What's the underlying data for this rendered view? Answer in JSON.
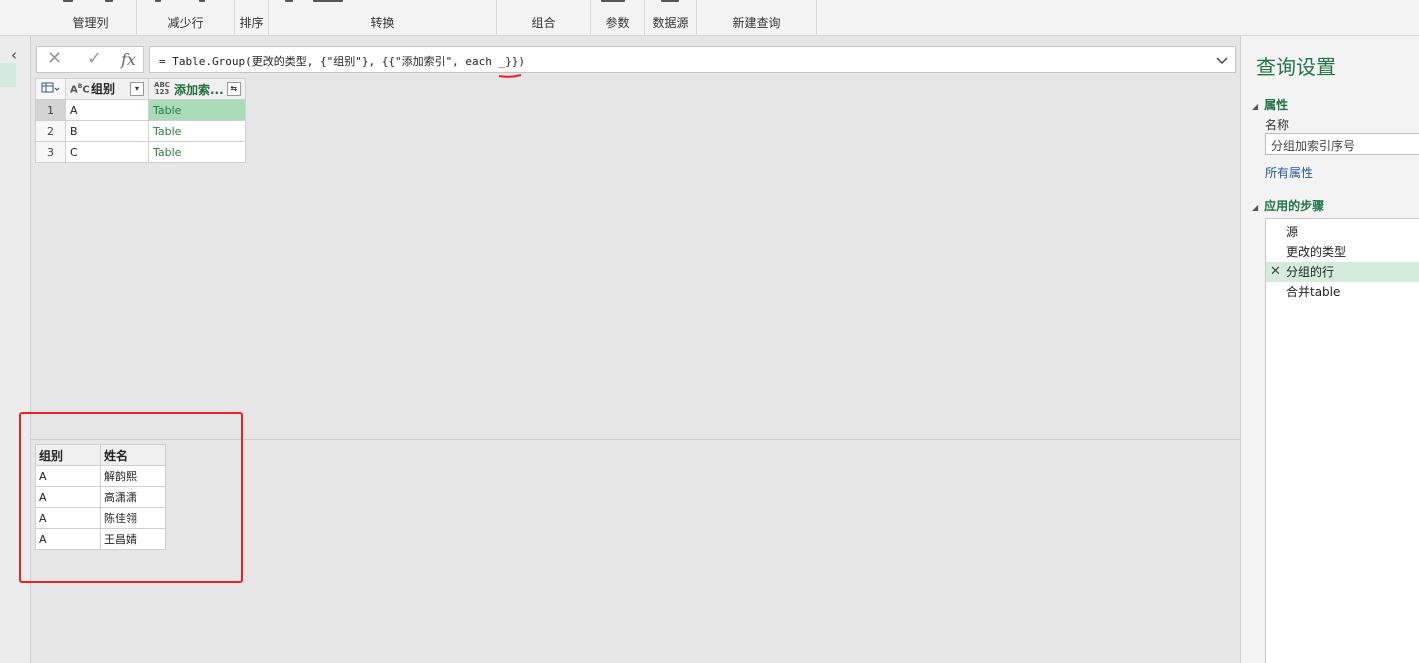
{
  "ribbon": {
    "groups": [
      "管理列",
      "减少行",
      "排序",
      "转换",
      "组合",
      "参数",
      "数据源",
      "新建查询"
    ]
  },
  "formula_bar": {
    "cancel_icon": "✕",
    "confirm_icon": "✓",
    "fx_icon": "fx",
    "formula": "= Table.Group(更改的类型, {\"组别\"}, {{\"添加索引\", each _}})",
    "dropdown_icon": "chevron-down-icon"
  },
  "grid": {
    "columns": [
      {
        "type_icon": "ABC",
        "name": "组别"
      },
      {
        "type_icon": "ABC/123",
        "name": "添加索..."
      }
    ],
    "rows": [
      {
        "num": "1",
        "group": "A",
        "value": "Table"
      },
      {
        "num": "2",
        "group": "B",
        "value": "Table"
      },
      {
        "num": "3",
        "group": "C",
        "value": "Table"
      }
    ]
  },
  "source_table": {
    "headers": [
      "组别",
      "姓名"
    ],
    "rows": [
      [
        "A",
        "解韵熙"
      ],
      [
        "A",
        "高潇潇"
      ],
      [
        "A",
        "陈佳翎"
      ],
      [
        "A",
        "王昌婧"
      ]
    ]
  },
  "query_settings": {
    "title": "查询设置",
    "properties_label": "属性",
    "name_label": "名称",
    "name_value": "分组加索引序号",
    "all_properties": "所有属性",
    "applied_steps_label": "应用的步骤",
    "steps": [
      "源",
      "更改的类型",
      "分组的行",
      "合并table"
    ],
    "active_step": 2
  },
  "colors": {
    "accent": "#217346",
    "highlight": "#e5242a"
  }
}
